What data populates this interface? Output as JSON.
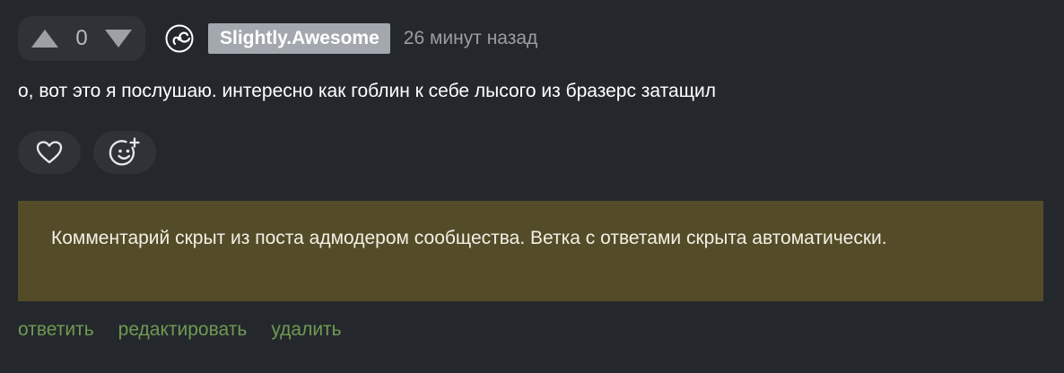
{
  "comment": {
    "rating": "0",
    "author": "Slightly.Awesome",
    "time": "26 минут назад",
    "text": "о, вот это я послушаю. интересно как гоблин к себе лысого из бразерс затащил",
    "notice": "Комментарий скрыт из поста адмодером сообщества. Ветка с ответами скрыта автоматически.",
    "actions": {
      "reply": "ответить",
      "edit": "редактировать",
      "delete": "удалить"
    },
    "icons": {
      "upvote": "triangle-up-icon",
      "downvote": "triangle-down-icon",
      "avatar": "spiral-avatar-icon",
      "like": "heart-icon",
      "add_reaction": "smiley-plus-icon"
    },
    "colors": {
      "background": "#24282d",
      "author_badge": "#a3a8ae",
      "notice_background": "#544c28",
      "action_link": "#6f9a52"
    }
  }
}
